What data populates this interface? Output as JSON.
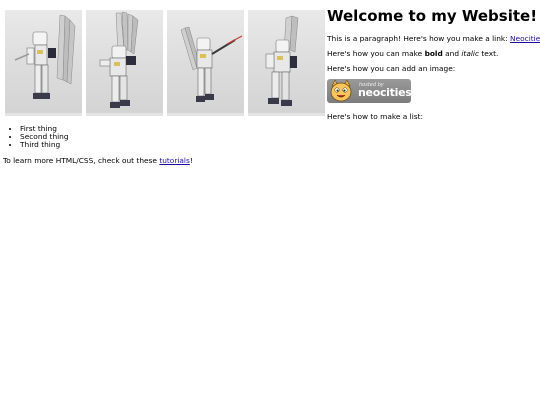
{
  "heading": "Welcome to my Website!",
  "paragraph_link": {
    "before": "This is a paragraph! Here's how you make a link: ",
    "link_text": "Neocities",
    "after": "."
  },
  "paragraph_bold": {
    "before": "Here's how you can make ",
    "bold": "bold",
    "middle": " and ",
    "italic": "italic",
    "after": " text."
  },
  "paragraph_image": "Here's how you can add an image:",
  "badge": {
    "top_text": "hosted by",
    "name": "neocities",
    "icon": "neocities-cat-icon"
  },
  "paragraph_list": "Here's how to make a list:",
  "list_items": [
    "First thing",
    "Second thing",
    "Third thing"
  ],
  "footer": {
    "before": "To learn more HTML/CSS, check out these ",
    "link_text": "tutorials",
    "after": "!"
  },
  "gallery": {
    "count": 4,
    "subject": "robot-figure-photo"
  },
  "colors": {
    "link": "#1a0dab",
    "badge_bg": "#8a8a8a",
    "photo_bg": "#e0e0e0"
  }
}
